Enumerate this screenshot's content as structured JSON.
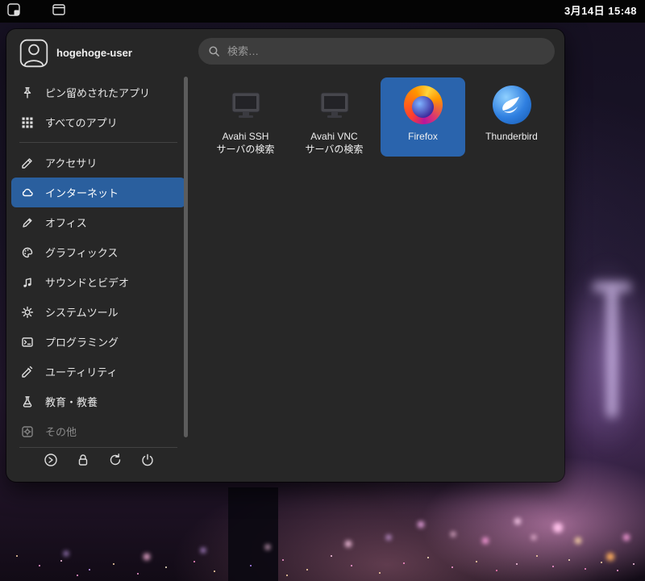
{
  "topbar": {
    "clock": "3月14日 15:48",
    "buttons": [
      {
        "icon": "app-menu-icon"
      },
      {
        "icon": "window-icon"
      }
    ]
  },
  "menu": {
    "header": {
      "username": "hogehoge-user",
      "search_placeholder": "検索…",
      "search_value": "",
      "icons": {
        "avatar": "user-avatar-icon",
        "search": "search-icon"
      }
    },
    "sidebar": {
      "pinned": {
        "label": "ピン留めされたアプリ",
        "icon": "pin-icon"
      },
      "all_apps": {
        "label": "すべてのアプリ",
        "icon": "apps-grid-icon"
      },
      "categories": [
        {
          "label": "アクセサリ",
          "icon": "accessories-icon",
          "selected": false
        },
        {
          "label": "インターネット",
          "icon": "internet-cloud-icon",
          "selected": true
        },
        {
          "label": "オフィス",
          "icon": "office-pencil-icon",
          "selected": false
        },
        {
          "label": "グラフィックス",
          "icon": "graphics-palette-icon",
          "selected": false
        },
        {
          "label": "サウンドとビデオ",
          "icon": "sound-video-icon",
          "selected": false
        },
        {
          "label": "システムツール",
          "icon": "system-tools-gear-icon",
          "selected": false
        },
        {
          "label": "プログラミング",
          "icon": "programming-terminal-icon",
          "selected": false
        },
        {
          "label": "ユーティリティ",
          "icon": "utilities-icon",
          "selected": false
        },
        {
          "label": "教育・教養",
          "icon": "education-flask-icon",
          "selected": false
        },
        {
          "label": "その他",
          "icon": "other-gear-icon",
          "selected": false,
          "dimmed": true
        }
      ],
      "session_buttons": [
        {
          "name": "run",
          "icon": "run-icon"
        },
        {
          "name": "lock",
          "icon": "lock-icon"
        },
        {
          "name": "restart",
          "icon": "restart-icon"
        },
        {
          "name": "power",
          "icon": "power-icon"
        }
      ]
    },
    "apps": [
      {
        "line1": "Avahi SSH",
        "line2": "サーバの検索",
        "icon": "monitor-icon",
        "selected": false
      },
      {
        "line1": "Avahi VNC",
        "line2": "サーバの検索",
        "icon": "monitor-icon",
        "selected": false
      },
      {
        "line1": "Firefox",
        "line2": "",
        "icon": "firefox-icon",
        "selected": true
      },
      {
        "line1": "Thunderbird",
        "line2": "",
        "icon": "thunderbird-icon",
        "selected": false
      }
    ]
  },
  "colors": {
    "sidebar_selected": "#2a5f9e",
    "tile_selected": "#2a64ad",
    "menu_bg": "#272727",
    "panel_bg": "#040404"
  }
}
